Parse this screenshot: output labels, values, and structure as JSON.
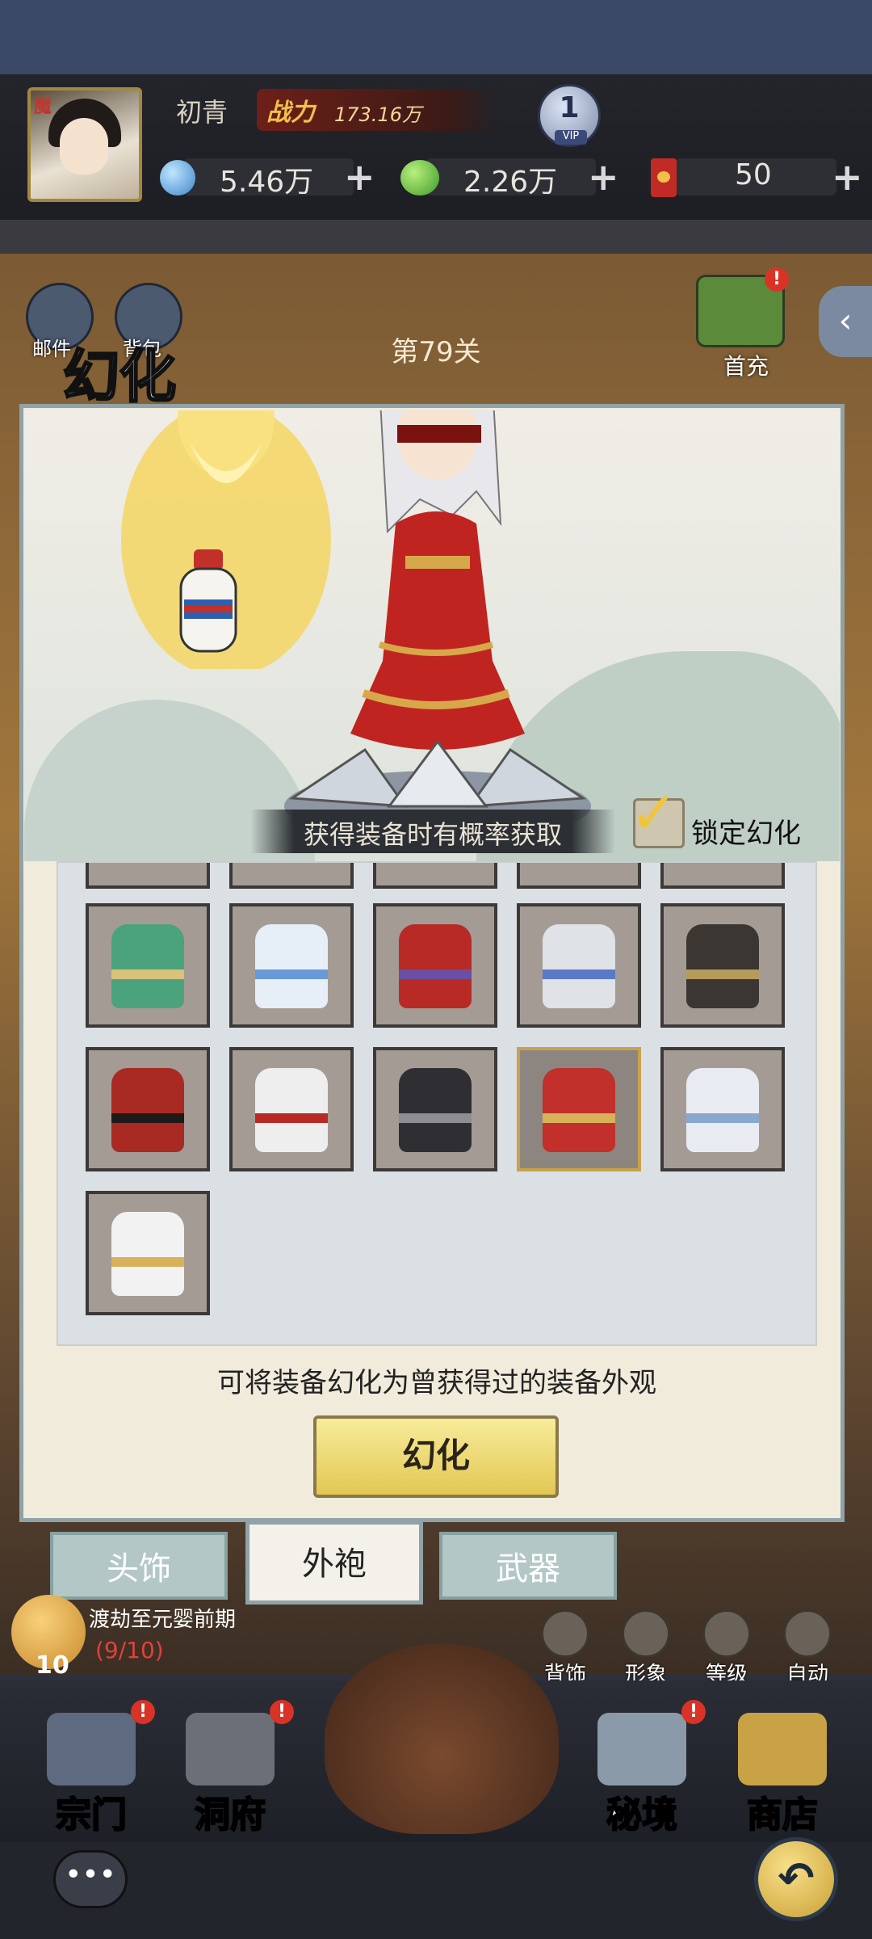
{
  "hud": {
    "avatar_tag": "魔",
    "player_name": "初青",
    "power_label": "战力",
    "power_value": "173.16万",
    "vip_level": "1",
    "vip_label": "VIP",
    "resources": [
      {
        "name": "spirit-stone",
        "value": "5.46万"
      },
      {
        "name": "jade",
        "value": "2.26万"
      },
      {
        "name": "ticket",
        "value": "50"
      }
    ],
    "plus": "+"
  },
  "scene": {
    "mail_label": "邮件",
    "backpack_label": "背包",
    "stage": "第79关",
    "first_charge_label": "首充",
    "back_arrow": "‹"
  },
  "panel": {
    "title": "幻化",
    "hint": "获得装备时有概率获取",
    "lock_label": "锁定幻化",
    "lock_checked": true,
    "description": "可将装备幻化为曾获得过的装备外观",
    "button_label": "幻化",
    "selected_index": 8,
    "items": [
      {
        "name": "jade-robe",
        "main": "#4aa37c",
        "accent": "#d9c27a"
      },
      {
        "name": "azure-robe",
        "main": "#e6eef8",
        "accent": "#6a9ad6"
      },
      {
        "name": "crimson-cloak",
        "main": "#b82a26",
        "accent": "#6b4fa2"
      },
      {
        "name": "mist-robe",
        "main": "#dfe2e7",
        "accent": "#5a7ac6"
      },
      {
        "name": "shadow-robe",
        "main": "#3b3632",
        "accent": "#b59b5c"
      },
      {
        "name": "flame-robe",
        "main": "#a82a22",
        "accent": "#1f1a18"
      },
      {
        "name": "white-sash-robe",
        "main": "#eeeeee",
        "accent": "#b82a26"
      },
      {
        "name": "dark-robe",
        "main": "#2f2f33",
        "accent": "#8d8d93"
      },
      {
        "name": "red-gold-robe",
        "main": "#c1302a",
        "accent": "#d8b25a"
      },
      {
        "name": "frost-robe",
        "main": "#e8ecf2",
        "accent": "#88a8d0"
      },
      {
        "name": "plain-white-robe",
        "main": "#f2f2f2",
        "accent": "#d8b25a"
      }
    ]
  },
  "tabs": {
    "head": "头饰",
    "robe": "外袍",
    "weapon": "武器"
  },
  "bottom": {
    "quest_text": "渡劫至元婴前期",
    "quest_progress": "(9/10)",
    "quest_number": "10",
    "side_buttons": [
      "背饰",
      "形象",
      "等级",
      "自动"
    ],
    "nav": [
      "宗门",
      "洞府",
      "秘境",
      "商店"
    ],
    "badge": "!",
    "chat": "•••",
    "return": "↶"
  }
}
